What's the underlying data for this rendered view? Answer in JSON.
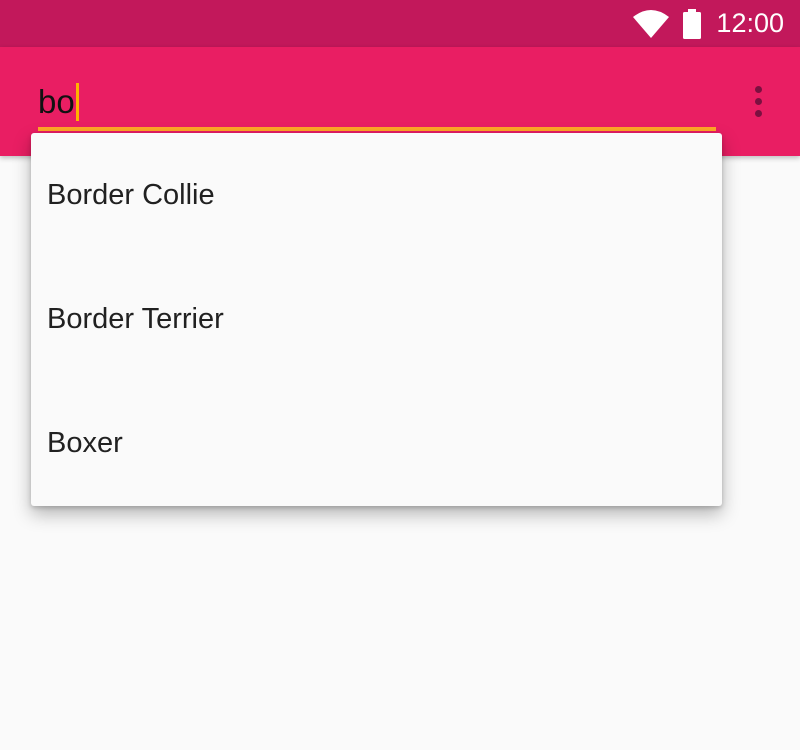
{
  "status_bar": {
    "time": "12:00",
    "icons": [
      "wifi-icon",
      "battery-icon"
    ]
  },
  "search": {
    "query": "bo"
  },
  "toolbar": {
    "overflow_icon": "more-vert-icon"
  },
  "suggestions": [
    {
      "label": "Border Collie"
    },
    {
      "label": "Border Terrier"
    },
    {
      "label": "Boxer"
    }
  ],
  "colors": {
    "status_bar": "#c2185b",
    "app_bar": "#e91e63",
    "accent": "#ffa726",
    "background": "#fafafa"
  }
}
